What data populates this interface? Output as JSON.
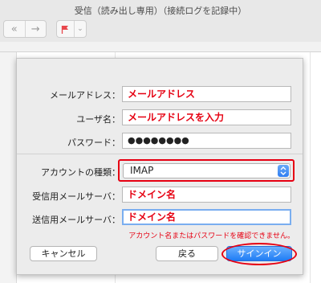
{
  "window": {
    "title": "受信（読み出し専用）（接続ログを記録中）"
  },
  "toolbar": {
    "back_icon": "reply-all-icon",
    "forward_icon": "forward-icon",
    "flag_icon": "flag-icon",
    "flag_menu_icon": "chevron-down-icon",
    "flag_color": "#e8474c"
  },
  "dialog": {
    "email_label": "メールアドレス：",
    "email_value": "メールアドレス",
    "username_label": "ユーザ名：",
    "username_value": "メールアドレスを入力",
    "password_label": "パスワード：",
    "password_value": "●●●●●●●●",
    "account_type_label": "アカウントの種類：",
    "account_type_value": "IMAP",
    "incoming_server_label": "受信用メールサーバ：",
    "incoming_server_value": "ドメイン名",
    "outgoing_server_label": "送信用メールサーバ：",
    "outgoing_server_value": "ドメイン名",
    "error_message": "アカウント名またはパスワードを確認できません。",
    "cancel_label": "キャンセル",
    "back_label": "戻る",
    "signin_label": "サインイン"
  },
  "colors": {
    "annotation_red": "#e60012",
    "primary_blue": "#1f7cf4",
    "focus_ring": "#7aaef0"
  }
}
